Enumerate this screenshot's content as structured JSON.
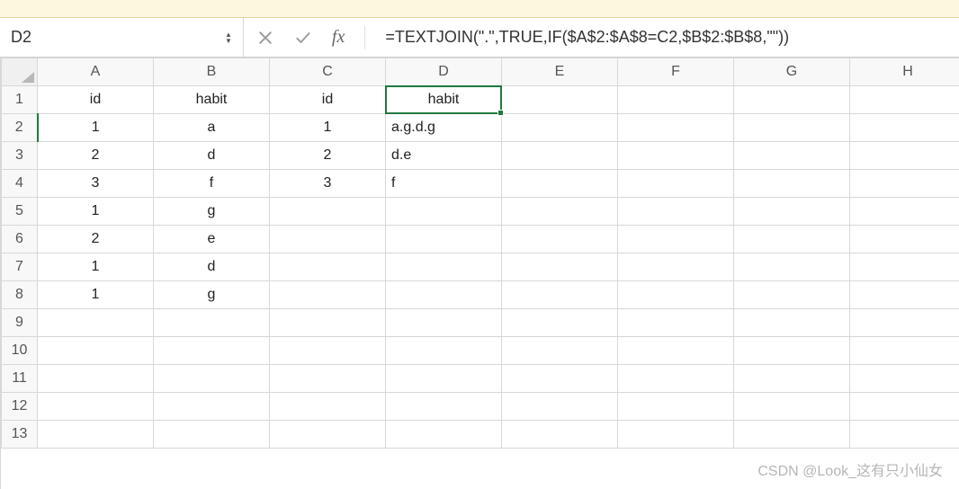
{
  "formula_bar": {
    "cell_ref": "D2",
    "formula": "=TEXTJOIN(\".\",TRUE,IF($A$2:$A$8=C2,$B$2:$B$8,\"\"))",
    "fx_label": "fx"
  },
  "columns": [
    "A",
    "B",
    "C",
    "D",
    "E",
    "F",
    "G",
    "H"
  ],
  "row_numbers": [
    "1",
    "2",
    "3",
    "4",
    "5",
    "6",
    "7",
    "8",
    "9",
    "10",
    "11",
    "12",
    "13"
  ],
  "active_col_index": 3,
  "active_row_index": 1,
  "cells": {
    "r1": {
      "A": "id",
      "B": "habit",
      "C": "id",
      "D": "habit"
    },
    "r2": {
      "A": "1",
      "B": "a",
      "C": "1",
      "D": "a.g.d.g"
    },
    "r3": {
      "A": "2",
      "B": "d",
      "C": "2",
      "D": "d.e"
    },
    "r4": {
      "A": "3",
      "B": "f",
      "C": "3",
      "D": "f"
    },
    "r5": {
      "A": "1",
      "B": "g"
    },
    "r6": {
      "A": "2",
      "B": "e"
    },
    "r7": {
      "A": "1",
      "B": "d"
    },
    "r8": {
      "A": "1",
      "B": "g"
    }
  },
  "watermark": "CSDN @Look_这有只小仙女"
}
